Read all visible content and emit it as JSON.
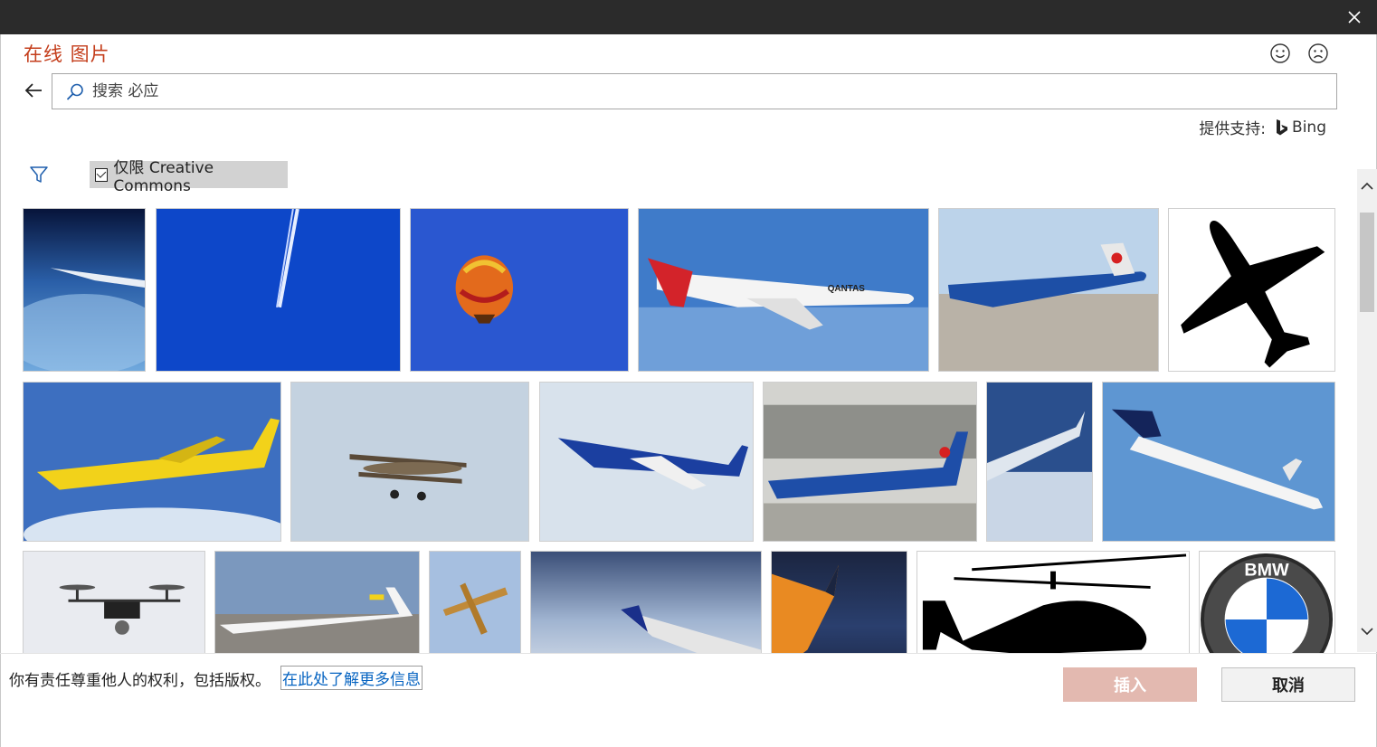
{
  "window": {
    "close_icon": "close-icon"
  },
  "dialog": {
    "title": "在线 图片",
    "feedback_positive_icon": "smiley-icon",
    "feedback_negative_icon": "frown-icon"
  },
  "search": {
    "placeholder": "搜索 必应",
    "value": ""
  },
  "provider": {
    "label": "提供支持:",
    "name": "Bing"
  },
  "filter": {
    "creative_commons_label": "仅限 Creative Commons",
    "creative_commons_checked": true
  },
  "results": [
    {
      "subject": "airplane wing above clouds from space"
    },
    {
      "subject": "contrail in blue sky"
    },
    {
      "subject": "hot air balloon"
    },
    {
      "subject": "Qantas A380 airliner",
      "text": "QANTAS"
    },
    {
      "subject": "Air China airliner on tarmac"
    },
    {
      "subject": "airplane silhouette"
    },
    {
      "subject": "yellow regional jet"
    },
    {
      "subject": "biplane"
    },
    {
      "subject": "blue airliner in flight"
    },
    {
      "subject": "airliner at airport terminal"
    },
    {
      "subject": "wing over snowy mountains"
    },
    {
      "subject": "regional jet landing"
    },
    {
      "subject": "quadcopter drone"
    },
    {
      "subject": "transport aircraft on runway"
    },
    {
      "subject": "small biplane from below"
    },
    {
      "subject": "wing over clouds at sunrise"
    },
    {
      "subject": "wing at sunset"
    },
    {
      "subject": "helicopter silhouette"
    },
    {
      "subject": "BMW logo",
      "text": "BMW"
    }
  ],
  "footer": {
    "note": "你有责任尊重他人的权利，包括版权。",
    "link": "在此处了解更多信息",
    "insert_label": "插入",
    "cancel_label": "取消"
  },
  "colors": {
    "title": "#c43e1c",
    "link": "#0563c1",
    "insert_disabled": "#e3b9b0"
  }
}
